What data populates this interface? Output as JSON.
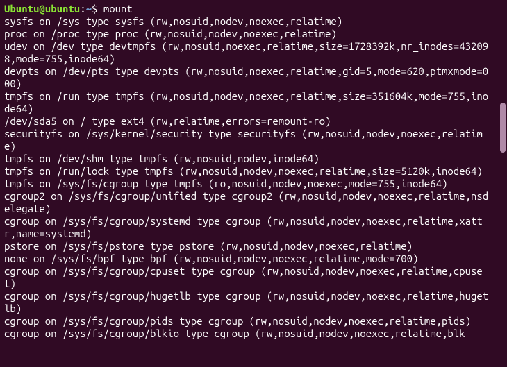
{
  "prompt": {
    "user": "Ubuntu@ubuntu",
    "separator": ":",
    "path": "~",
    "symbol": "$ "
  },
  "command": "mount",
  "output_lines": [
    "sysfs on /sys type sysfs (rw,nosuid,nodev,noexec,relatime)",
    "proc on /proc type proc (rw,nosuid,nodev,noexec,relatime)",
    "udev on /dev type devtmpfs (rw,nosuid,noexec,relatime,size=1728392k,nr_inodes=432098,mode=755,inode64)",
    "devpts on /dev/pts type devpts (rw,nosuid,noexec,relatime,gid=5,mode=620,ptmxmode=000)",
    "tmpfs on /run type tmpfs (rw,nosuid,nodev,noexec,relatime,size=351604k,mode=755,inode64)",
    "/dev/sda5 on / type ext4 (rw,relatime,errors=remount-ro)",
    "securityfs on /sys/kernel/security type securityfs (rw,nosuid,nodev,noexec,relatime)",
    "tmpfs on /dev/shm type tmpfs (rw,nosuid,nodev,inode64)",
    "tmpfs on /run/lock type tmpfs (rw,nosuid,nodev,noexec,relatime,size=5120k,inode64)",
    "tmpfs on /sys/fs/cgroup type tmpfs (ro,nosuid,nodev,noexec,mode=755,inode64)",
    "cgroup2 on /sys/fs/cgroup/unified type cgroup2 (rw,nosuid,nodev,noexec,relatime,nsdelegate)",
    "cgroup on /sys/fs/cgroup/systemd type cgroup (rw,nosuid,nodev,noexec,relatime,xattr,name=systemd)",
    "pstore on /sys/fs/pstore type pstore (rw,nosuid,nodev,noexec,relatime)",
    "none on /sys/fs/bpf type bpf (rw,nosuid,nodev,noexec,relatime,mode=700)",
    "cgroup on /sys/fs/cgroup/cpuset type cgroup (rw,nosuid,nodev,noexec,relatime,cpuset)",
    "cgroup on /sys/fs/cgroup/hugetlb type cgroup (rw,nosuid,nodev,noexec,relatime,hugetlb)",
    "cgroup on /sys/fs/cgroup/pids type cgroup (rw,nosuid,nodev,noexec,relatime,pids)",
    "cgroup on /sys/fs/cgroup/blkio type cgroup (rw,nosuid,nodev,noexec,relatime,blk"
  ]
}
